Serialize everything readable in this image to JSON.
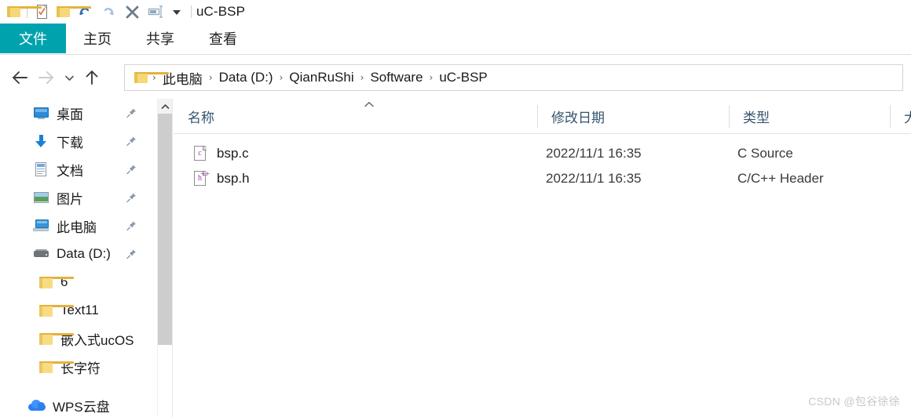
{
  "window": {
    "title": "uC-BSP",
    "quick_access": [
      {
        "name": "folder-icon",
        "label": ""
      },
      {
        "name": "properties-icon",
        "label": ""
      },
      {
        "name": "new-folder-icon",
        "label": ""
      },
      {
        "name": "undo-icon",
        "label": "↶"
      },
      {
        "name": "redo-icon",
        "label": "↷"
      },
      {
        "name": "delete-icon",
        "label": "✕"
      },
      {
        "name": "rename-icon",
        "label": ""
      },
      {
        "name": "customize-dropdown-icon",
        "label": "▼"
      }
    ]
  },
  "ribbon": {
    "tabs": [
      {
        "label": "文件",
        "active": true
      },
      {
        "label": "主页",
        "active": false
      },
      {
        "label": "共享",
        "active": false
      },
      {
        "label": "查看",
        "active": false
      }
    ]
  },
  "nav": {
    "back_icon": "←",
    "forward_icon": "→",
    "recent_icon": "⌄",
    "up_icon": "↑",
    "breadcrumb": [
      "此电脑",
      "Data (D:)",
      "QianRuShi",
      "Software",
      "uC-BSP"
    ],
    "separator": "›"
  },
  "sidebar": {
    "quick_items": [
      {
        "label": "桌面",
        "icon": "desktop-icon",
        "pinned": true
      },
      {
        "label": "下载",
        "icon": "download-icon",
        "pinned": true
      },
      {
        "label": "文档",
        "icon": "document-icon",
        "pinned": true
      },
      {
        "label": "图片",
        "icon": "pictures-icon",
        "pinned": true
      },
      {
        "label": "此电脑",
        "icon": "this-pc-icon",
        "pinned": true
      },
      {
        "label": "Data (D:)",
        "icon": "drive-icon",
        "pinned": true
      }
    ],
    "folder_items": [
      {
        "label": "6",
        "icon": "folder-icon"
      },
      {
        "label": "Text11",
        "icon": "folder-icon"
      },
      {
        "label": "嵌入式ucOS",
        "icon": "folder-icon"
      },
      {
        "label": "长字符",
        "icon": "folder-icon"
      }
    ],
    "cloud_items": [
      {
        "label": "WPS云盘",
        "icon": "cloud-icon"
      }
    ],
    "scrollbar": {
      "up_arrow": "⌃"
    }
  },
  "filelist": {
    "columns": [
      {
        "label": "名称",
        "sorted": "asc",
        "sort_caret": "⌃"
      },
      {
        "label": "修改日期",
        "sorted": ""
      },
      {
        "label": "类型",
        "sorted": ""
      },
      {
        "label": "大",
        "sorted": ""
      }
    ],
    "rows": [
      {
        "name": "bsp.c",
        "date": "2022/11/1 16:35",
        "type": "C Source",
        "icon": "c-source-file-icon",
        "letter": "c",
        "plus": ""
      },
      {
        "name": "bsp.h",
        "date": "2022/11/1 16:35",
        "type": "C/C++ Header",
        "icon": "c-header-file-icon",
        "letter": "h",
        "plus": "++"
      }
    ]
  },
  "watermark": {
    "text": "CSDN @包谷徐徐"
  },
  "colors": {
    "accent_teal": "#00A3AD",
    "top_bar_teal": "#00AEC7",
    "folder_yellow": "#F8DC84",
    "header_text": "#35536E",
    "file_letter_purple": "#9B3FA8"
  }
}
